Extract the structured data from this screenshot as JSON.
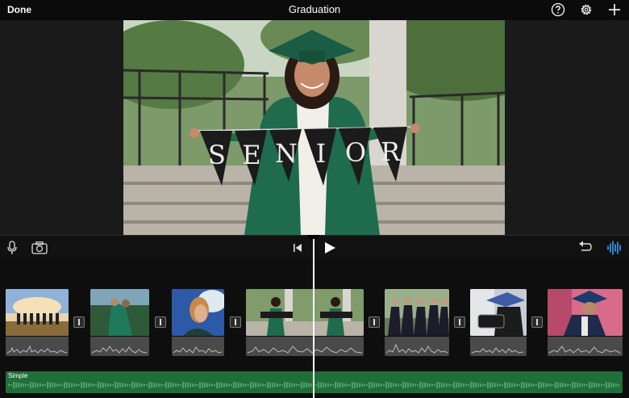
{
  "topbar": {
    "done_label": "Done",
    "project_title": "Graduation",
    "icons": [
      "help-icon",
      "settings-icon",
      "add-icon"
    ]
  },
  "preview": {
    "banner_letters": [
      "S",
      "E",
      "N",
      "I",
      "O",
      "R"
    ]
  },
  "toolbar": {
    "icons": [
      "microphone-icon",
      "camera-icon",
      "skip-to-start-icon",
      "play-icon",
      "undo-icon",
      "audio-waveform-icon"
    ]
  },
  "timeline": {
    "clips": [
      {
        "name": "clip-group-toss",
        "thumb_colors": [
          "#c9a77a",
          "#6a8cc0"
        ]
      },
      {
        "name": "clip-two-graduates",
        "thumb_colors": [
          "#3a7a4a",
          "#8fb59a"
        ]
      },
      {
        "name": "clip-portrait-side",
        "thumb_colors": [
          "#2e5fa8",
          "#d7a46a"
        ]
      },
      {
        "name": "clip-senior-banner",
        "thumb_colors": [
          "#5b7a52",
          "#c7c0b2"
        ]
      },
      {
        "name": "clip-graduates-group",
        "thumb_colors": [
          "#2a2a3a",
          "#9ab08a"
        ]
      },
      {
        "name": "clip-cap-sign",
        "thumb_colors": [
          "#3d5da8",
          "#1c1c1c"
        ]
      },
      {
        "name": "clip-cap-closeup",
        "thumb_colors": [
          "#1c3a6c",
          "#d86a8a"
        ]
      }
    ],
    "music_track_label": "Simple",
    "colors": {
      "music": "#1f6f3a",
      "waveform": "#4a4a4a"
    }
  }
}
